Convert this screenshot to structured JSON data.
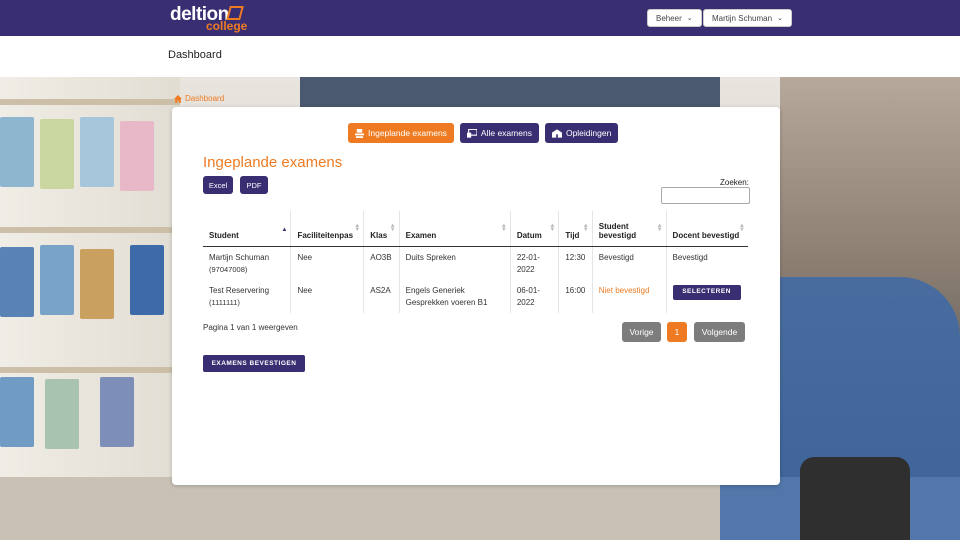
{
  "header": {
    "logo_main": "deltion",
    "logo_sub": "college",
    "menu_beheer": "Beheer",
    "menu_user": "Martijn Schuman"
  },
  "subheader": {
    "title": "Dashboard"
  },
  "breadcrumb": {
    "label": "Dashboard"
  },
  "tabs": [
    {
      "label": "Ingeplande examens",
      "icon": "exam-icon",
      "active": true
    },
    {
      "label": "Alle examens",
      "icon": "monitor-icon",
      "active": false
    },
    {
      "label": "Opleidingen",
      "icon": "school-icon",
      "active": false
    }
  ],
  "section": {
    "heading": "Ingeplande examens",
    "excel_label": "Excel",
    "pdf_label": "PDF",
    "search_label": "Zoeken:",
    "search_value": ""
  },
  "table": {
    "headers": [
      "Student",
      "Faciliteitenpas",
      "Klas",
      "Examen",
      "Datum",
      "Tijd",
      "Student bevestigd",
      "Docent bevestigd"
    ],
    "rows": [
      {
        "student": "Martijn Schuman",
        "student_id": "(97047008)",
        "faciliteitenpas": "Nee",
        "klas": "AO3B",
        "examen": "Duits Spreken",
        "datum": "22-01-2022",
        "tijd": "12:30",
        "student_bevestigd": "Bevestigd",
        "docent_bevestigd": "Bevestigd"
      },
      {
        "student": "Test Reservering",
        "student_id": "(1111111)",
        "faciliteitenpas": "Nee",
        "klas": "AS2A",
        "examen": "Engels Generiek Gesprekken voeren B1",
        "datum": "06-01-2022",
        "tijd": "16:00",
        "student_bevestigd": "Niet bevestigd",
        "docent_bevestigd_button": "SELECTEREN"
      }
    ]
  },
  "pagination": {
    "info": "Pagina 1 van 1 weergeven",
    "prev": "Vorige",
    "current": "1",
    "next": "Volgende"
  },
  "confirm_button": "EXAMENS BEVESTIGEN",
  "colors": {
    "primary": "#3a2e73",
    "accent": "#ee7b22",
    "pager_grey": "#7d7d7d"
  }
}
